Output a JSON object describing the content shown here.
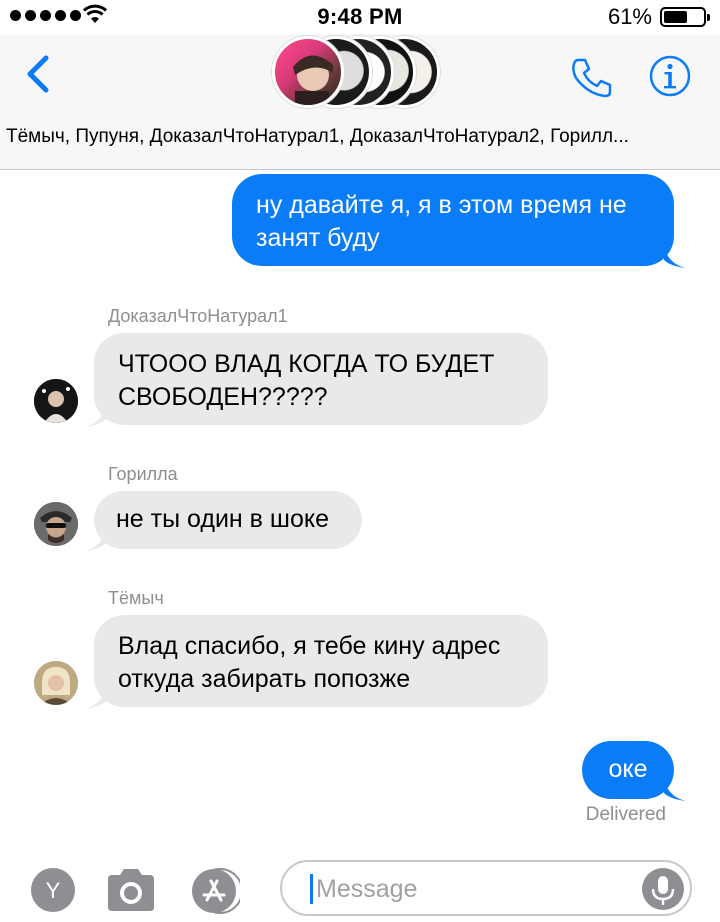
{
  "status": {
    "time": "9:48 PM",
    "battery_pct": "61%",
    "battery_level": 0.61
  },
  "header": {
    "members": "Тёмыч, Пупуня, ДоказалЧтоНатурал1, ДоказалЧтоНатурал2, Горилл..."
  },
  "messages": [
    {
      "direction": "outgoing",
      "text": "ну давайте я, я в этом время не занят буду"
    },
    {
      "direction": "incoming",
      "sender": "ДоказалЧтоНатурал1",
      "text": "ЧТООО ВЛАД КОГДА ТО БУДЕТ СВОБОДЕН?????"
    },
    {
      "direction": "incoming",
      "sender": "Горилла",
      "text": "не ты один в шоке"
    },
    {
      "direction": "incoming",
      "sender": "Тёмыч",
      "text": "Влад спасибо, я тебе кину адрес откуда забирать попозже"
    },
    {
      "direction": "outgoing",
      "text": "оке"
    }
  ],
  "delivered_label": "Delivered",
  "input": {
    "placeholder": "Message"
  },
  "colors": {
    "accent": "#0b7cf7",
    "incoming_bubble": "#e9e9eb",
    "secondary_text": "#8e8e93"
  },
  "icons": {
    "back": "chevron-left-icon",
    "call": "phone-icon",
    "info": "info-icon",
    "digital_touch": "digital-touch-icon",
    "camera": "camera-icon",
    "app_store": "app-store-icon",
    "mic": "microphone-icon"
  }
}
